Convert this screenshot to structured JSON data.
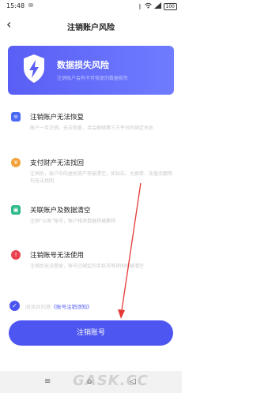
{
  "status_bar": {
    "time": "15:48",
    "battery": "100"
  },
  "header": {
    "title": "注销账户风险"
  },
  "banner": {
    "title": "数据损失风险",
    "subtitle": "注销账户会有不可恢复的数据损失"
  },
  "items": [
    {
      "title": "注销账户无法恢复",
      "desc": "账户一旦注销，无法恢复，且会解绑第三方平台的绑定关系",
      "icon_color": "#4b6af3",
      "icon_glyph": "≡"
    },
    {
      "title": "支付财产无法找回",
      "desc": "注销后，账户中的虚拟资产将被清空，如钻石、兑换券、充值余额等均无法找回",
      "icon_color": "#f2a23c",
      "icon_glyph": "¥"
    },
    {
      "title": "关联账户及数据清空",
      "desc": "注销“斗鱼”账号，账户相关数据将被删除",
      "icon_color": "#2db98a",
      "icon_glyph": "▣"
    },
    {
      "title": "注销账号无法使用",
      "desc": "注销后无法登录，账号已绑定的手机号等将同时被清空",
      "icon_color": "#e8424e",
      "icon_glyph": "!"
    }
  ],
  "agreement": {
    "prefix": "阅读并同意",
    "link": "《账号注销须知》"
  },
  "buttons": {
    "cancel_account": "注销账号"
  },
  "watermark": "GASK.CC"
}
